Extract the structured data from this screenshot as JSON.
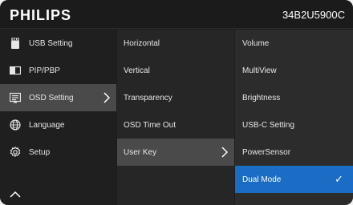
{
  "header": {
    "brand": "PHILIPS",
    "model": "34B2U5900C"
  },
  "menu": {
    "main": [
      {
        "label": "USB Setting",
        "icon": "usb-icon"
      },
      {
        "label": "PIP/PBP",
        "icon": "pip-icon"
      },
      {
        "label": "OSD Setting",
        "icon": "osd-icon",
        "selected": true
      },
      {
        "label": "Language",
        "icon": "globe-icon"
      },
      {
        "label": "Setup",
        "icon": "gear-icon"
      }
    ],
    "osd_setting": [
      {
        "label": "Horizontal"
      },
      {
        "label": "Vertical"
      },
      {
        "label": "Transparency"
      },
      {
        "label": "OSD Time Out"
      },
      {
        "label": "User Key",
        "selected": true
      }
    ],
    "user_key": [
      {
        "label": "Volume"
      },
      {
        "label": "MultiView"
      },
      {
        "label": "Brightness"
      },
      {
        "label": "USB-C Setting"
      },
      {
        "label": "PowerSensor"
      },
      {
        "label": "Dual Mode",
        "selected": true,
        "checked": true
      }
    ]
  },
  "glyphs": {
    "check": "✓"
  },
  "colors": {
    "highlight_grey": "#4a4a4a",
    "highlight_blue": "#1a6cc4"
  }
}
